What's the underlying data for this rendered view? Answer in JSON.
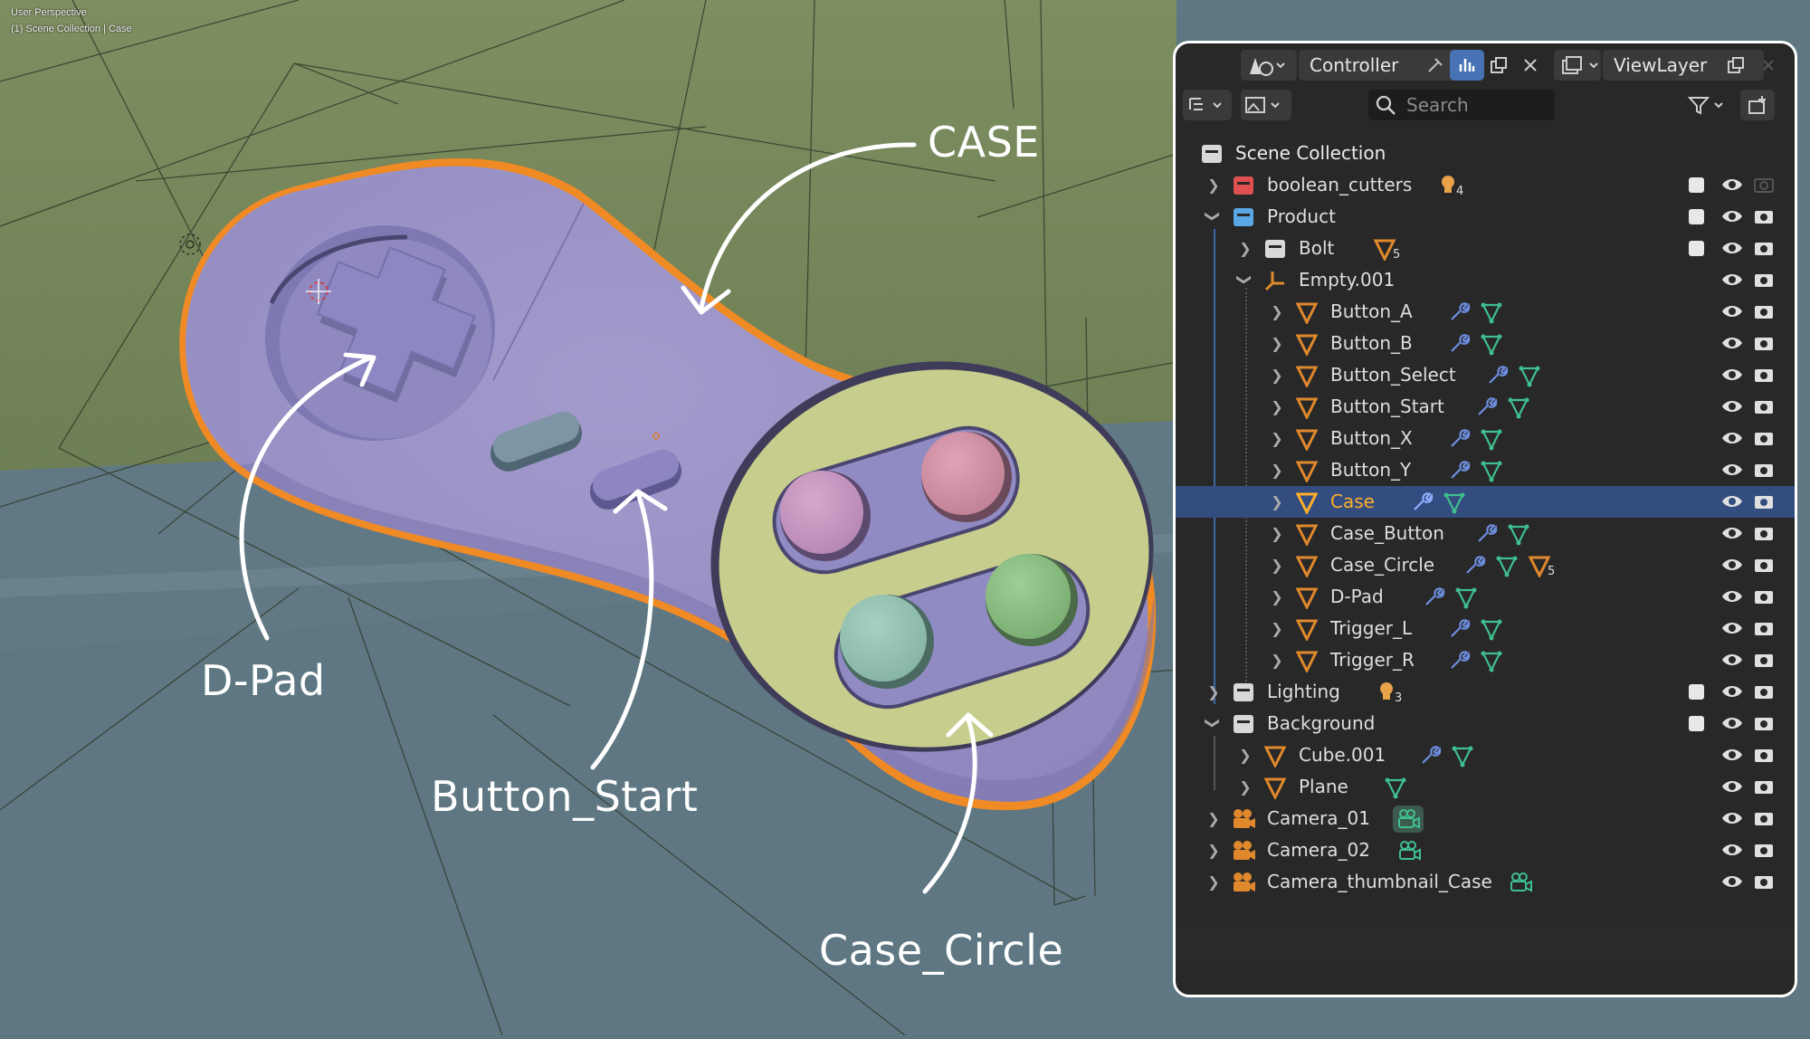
{
  "viewport": {
    "perspective_label": "User Perspective",
    "collection_label": "(1) Scene Collection | Case",
    "annotations": {
      "case": "CASE",
      "dpad": "D-Pad",
      "button_start": "Button_Start",
      "case_circle": "Case_Circle"
    },
    "colors": {
      "floor_green": "#7a8b5c",
      "floor_blue": "#5d7680",
      "controller_purple": "#9a93c4",
      "circle_green": "#c8cf8e",
      "selection_orange": "#f08a24"
    }
  },
  "outliner": {
    "header": {
      "scene_name": "Controller",
      "view_layer_name": "ViewLayer",
      "search_placeholder": "Search"
    },
    "root_label": "Scene Collection",
    "rows": [
      {
        "label": "boolean_cutters",
        "badge": "4"
      },
      {
        "label": "Product"
      },
      {
        "label": "Bolt",
        "badge": "5"
      },
      {
        "label": "Empty.001"
      },
      {
        "label": "Button_A"
      },
      {
        "label": "Button_B"
      },
      {
        "label": "Button_Select"
      },
      {
        "label": "Button_Start"
      },
      {
        "label": "Button_X"
      },
      {
        "label": "Button_Y"
      },
      {
        "label": "Case"
      },
      {
        "label": "Case_Button"
      },
      {
        "label": "Case_Circle",
        "badge": "5"
      },
      {
        "label": "D-Pad"
      },
      {
        "label": "Trigger_L"
      },
      {
        "label": "Trigger_R"
      },
      {
        "label": "Lighting",
        "badge": "3"
      },
      {
        "label": "Background"
      },
      {
        "label": "Cube.001"
      },
      {
        "label": "Plane"
      },
      {
        "label": "Camera_01"
      },
      {
        "label": "Camera_02"
      },
      {
        "label": "Camera_thumbnail_Case"
      }
    ],
    "colors": {
      "panel_bg": "#282828",
      "selected_row": "#334d80",
      "selected_text": "#ffaf29",
      "mesh_orange": "#e0882c",
      "modifier_blue": "#6d8ee0",
      "data_green": "#3fbf8f"
    }
  }
}
